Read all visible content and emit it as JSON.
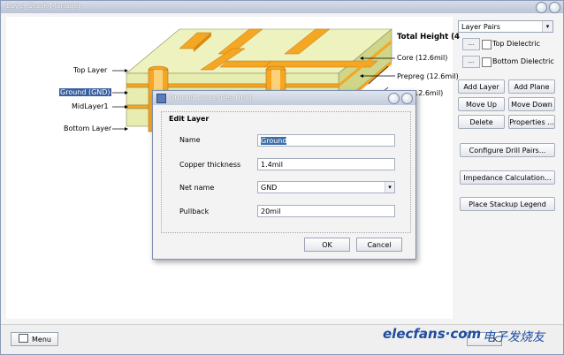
{
  "window": {
    "title": "Layer Stack Manager"
  },
  "diagram": {
    "layer_labels": [
      "Top Layer",
      "Ground (GND)",
      "MidLayer1",
      "Bottom Layer"
    ],
    "total_height": "Total Height (4",
    "callouts": [
      "Core (12.6mil)",
      "Prepreg (12.6mil)",
      "(12.6mil)"
    ]
  },
  "right_panel": {
    "preset_combo": "Layer Pairs",
    "top_dielectric_btn": "...",
    "top_dielectric": "Top Dielectric",
    "bottom_dielectric_btn": "...",
    "bottom_dielectric": "Bottom Dielectric",
    "buttons": {
      "add_layer": "Add Layer",
      "add_plane": "Add Plane",
      "move_up": "Move Up",
      "move_down": "Move Down",
      "delete": "Delete",
      "properties": "Properties ...",
      "configure_drill": "Configure Drill Pairs...",
      "impedance": "Impedance Calculation...",
      "place_legend": "Place Stackup Legend"
    }
  },
  "statusbar": {
    "menu": "Menu",
    "ok_partial": "K"
  },
  "dialog": {
    "title": "Ground properties [mil]",
    "group_title": "Edit Layer",
    "fields": {
      "name_label": "Name",
      "name_value": "Ground",
      "copper_label": "Copper thickness",
      "copper_value": "1.4mil",
      "net_label": "Net name",
      "net_value": "GND",
      "pullback_label": "Pullback",
      "pullback_value": "20mil"
    },
    "ok": "OK",
    "cancel": "Cancel"
  },
  "watermark": {
    "brand": "elecfans·com",
    "cn": "电子发烧友"
  },
  "colors": {
    "copper": "#f5a623",
    "laminate": "#e7ecb0",
    "laminate_side": "#cfd68a",
    "accent": "#1e4da0"
  }
}
